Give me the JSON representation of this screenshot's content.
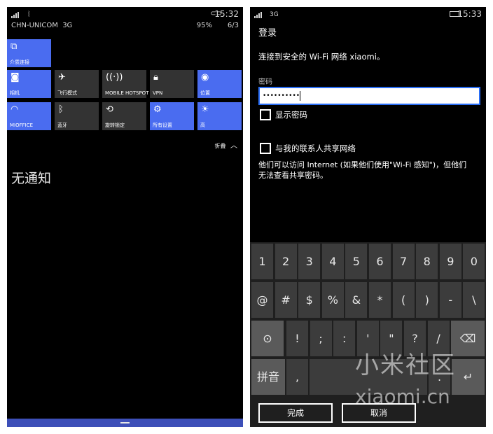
{
  "left": {
    "status": {
      "carrier": "CHN-UNICOM",
      "network": "3G",
      "time": "15:32",
      "battery": "95%",
      "date": "6/3"
    },
    "tiles": [
      {
        "label": "介质连接",
        "icon": "media-link-icon",
        "glyph": "⧉",
        "on": true
      },
      {
        "label": "相机",
        "icon": "camera-icon",
        "glyph": "◙",
        "on": true
      },
      {
        "label": "飞行模式",
        "icon": "airplane-icon",
        "glyph": "✈",
        "on": false
      },
      {
        "label": "MOBILE HOTSPOT",
        "icon": "hotspot-icon",
        "glyph": "((·))",
        "on": false
      },
      {
        "label": "VPN",
        "icon": "lock-icon",
        "glyph": "🔒︎",
        "on": false
      },
      {
        "label": "位置",
        "icon": "location-icon",
        "glyph": "◉",
        "on": true
      },
      {
        "label": "MIOFFICE",
        "icon": "wifi-icon",
        "glyph": "◠",
        "on": true
      },
      {
        "label": "蓝牙",
        "icon": "bluetooth-icon",
        "glyph": "ᛒ",
        "on": false
      },
      {
        "label": "旋转锁定",
        "icon": "rotation-lock-icon",
        "glyph": "⟲",
        "on": false
      },
      {
        "label": "所有设置",
        "icon": "gear-icon",
        "glyph": "⚙",
        "on": true
      },
      {
        "label": "高",
        "icon": "brightness-icon",
        "glyph": "☀",
        "on": true
      }
    ],
    "collapse_label": "折叠",
    "no_notifications": "无通知"
  },
  "right": {
    "status": {
      "network": "3G",
      "time": "15:33"
    },
    "title": "登录",
    "connect_text": "连接到安全的 Wi-Fi 网络 xiaomi。",
    "password_label": "密码",
    "password_value": "••••••••••",
    "show_password": "显示密码",
    "share_label": "与我的联系人共享网络",
    "share_desc_line1": "他们可以访问 Internet (如果他们使用\"Wi-Fi 感知\")，但他们",
    "share_desc_line2": "无法查看共享密码。",
    "keyboard": {
      "row1": [
        "1",
        "2",
        "3",
        "4",
        "5",
        "6",
        "7",
        "8",
        "9",
        "0"
      ],
      "row2": [
        "@",
        "#",
        "$",
        "%",
        "&",
        "*",
        "(",
        ")",
        "-",
        "\\"
      ],
      "row3": [
        "!",
        ";",
        ":",
        "'",
        "\"",
        "?",
        "/"
      ],
      "ime_label": "拼音",
      "comma": ",",
      "period": "."
    },
    "done_label": "完成",
    "cancel_label": "取消",
    "watermark_line1": "小米社区",
    "watermark_line2": "xiaomi.cn"
  }
}
